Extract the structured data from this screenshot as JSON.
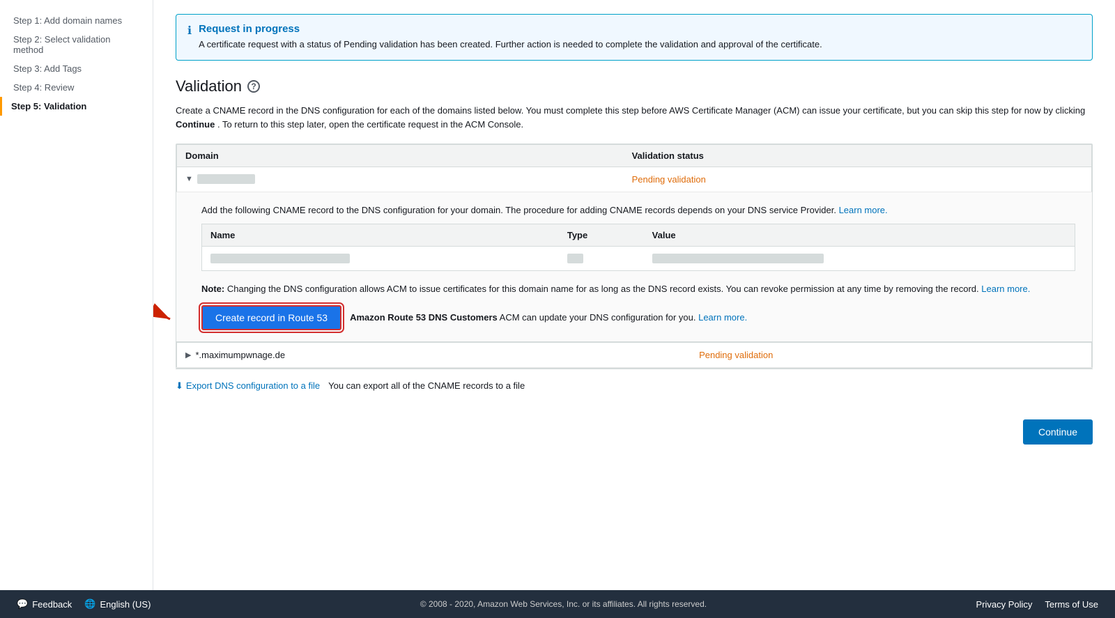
{
  "sidebar": {
    "items": [
      {
        "id": "step1",
        "label": "Step 1: Add domain names",
        "active": false
      },
      {
        "id": "step2",
        "label": "Step 2: Select validation method",
        "active": false
      },
      {
        "id": "step3",
        "label": "Step 3: Add Tags",
        "active": false
      },
      {
        "id": "step4",
        "label": "Step 4: Review",
        "active": false
      },
      {
        "id": "step5",
        "label": "Step 5: Validation",
        "active": true
      }
    ]
  },
  "banner": {
    "title": "Request in progress",
    "text": "A certificate request with a status of Pending validation has been created. Further action is needed to complete the validation and approval of the certificate."
  },
  "validation": {
    "title": "Validation",
    "description": "Create a CNAME record in the DNS configuration for each of the domains listed below. You must complete this step before AWS Certificate Manager (ACM) can issue your certificate, but you can skip this step for now by clicking",
    "description_bold": "Continue",
    "description_end": ". To return to this step later, open the certificate request in the ACM Console.",
    "table": {
      "col_domain": "Domain",
      "col_status": "Validation status",
      "domain1": {
        "name_blurred": "xxxxxxxxxxxxxxx.xx",
        "status": "Pending validation",
        "expanded_desc": "Add the following CNAME record to the DNS configuration for your domain. The procedure for adding CNAME records depends on your DNS service Provider.",
        "learn_more": "Learn more.",
        "cname": {
          "col_name": "Name",
          "col_type": "Type",
          "col_value": "Value",
          "name_val": "xxxxxxxxxxxxxxxxxxxxxxxxxxxxxxxxxxxxxxxxxxxxxxxx",
          "type_val": "CNAME",
          "value_val": "xxxxxxxxxxxxxxxxxxxxxxxxxxxxxxxxxxxxxxxxxxxxxxxxxxxxxxxxxxxxxxxx"
        },
        "note": "Note: Changing the DNS configuration allows ACM to issue certificates for this domain name for as long as the DNS record exists. You can revoke permission at any time by removing the record.",
        "note_learn_more": "Learn more.",
        "btn_create": "Create record in Route 53",
        "route53_text_bold": "Amazon Route 53 DNS Customers",
        "route53_text": " ACM can update your DNS configuration for you.",
        "route53_learn_more": "Learn more."
      },
      "domain2": {
        "name": "*.maximumpwnage.de",
        "status": "Pending validation"
      }
    }
  },
  "export": {
    "link": "Export DNS configuration to a file",
    "desc": "You can export all of the CNAME records to a file"
  },
  "footer": {
    "continue_label": "Continue"
  },
  "bottom_bar": {
    "feedback": "Feedback",
    "language": "English (US)",
    "copyright": "© 2008 - 2020, Amazon Web Services, Inc. or its affiliates. All rights reserved.",
    "privacy": "Privacy Policy",
    "terms": "Terms of Use"
  }
}
